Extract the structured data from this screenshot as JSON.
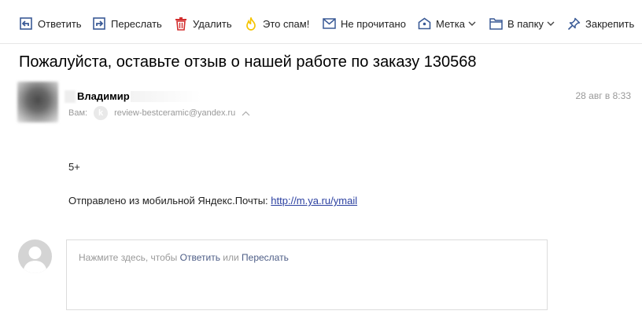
{
  "toolbar": {
    "items": [
      {
        "label": "Ответить",
        "icon": "reply-icon"
      },
      {
        "label": "Переслать",
        "icon": "forward-icon"
      },
      {
        "label": "Удалить",
        "icon": "trash-icon"
      },
      {
        "label": "Это спам!",
        "icon": "spam-flame-icon"
      },
      {
        "label": "Не прочитано",
        "icon": "envelope-icon"
      },
      {
        "label": "Метка",
        "icon": "tag-icon"
      },
      {
        "label": "В папку",
        "icon": "folder-icon"
      },
      {
        "label": "Закрепить",
        "icon": "pin-icon"
      }
    ]
  },
  "message": {
    "subject": "Пожалуйста, оставьте отзыв о нашей работе по заказу 130568",
    "sender_name": "Владимир",
    "to_label": "Вам:",
    "to_badge": "k",
    "to_email": "review-bestceramic@yandex.ru",
    "date": "28 авг в 8:33",
    "body_line1": "5+",
    "body_line2_prefix": "Отправлено из мобильной Яндекс.Почты: ",
    "body_link": "http://m.ya.ru/ymail"
  },
  "reply": {
    "prefix": "Нажмите здесь, чтобы ",
    "reply_link": "Ответить",
    "middle": " или ",
    "forward_link": "Переслать"
  },
  "colors": {
    "delete_icon": "#d32f2f",
    "spam_icon": "#f5c400",
    "icon_blue": "#3a5a96",
    "link": "#2a3fa0"
  }
}
